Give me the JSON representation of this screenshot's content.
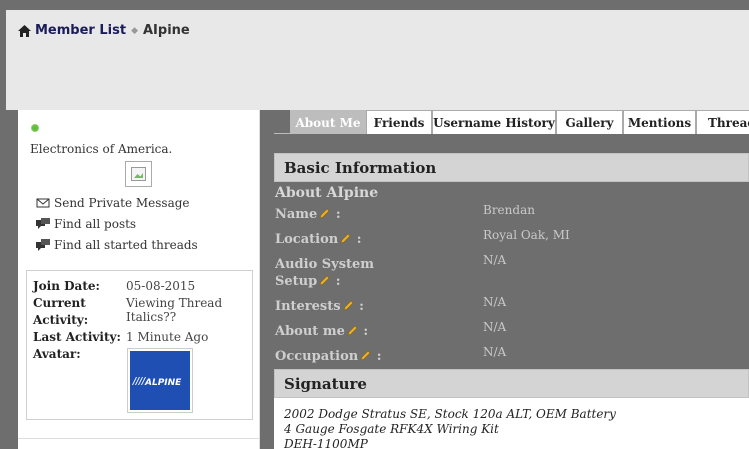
{
  "breadcrumb": {
    "home_icon": "home-icon",
    "link": "Member List",
    "separator_icon": "chevron-right-icon",
    "current": "AIpine"
  },
  "sidebar": {
    "status": "online",
    "usertitle": "Electronics of America.",
    "actions": [
      {
        "icon": "envelope-icon",
        "label": "Send Private Message"
      },
      {
        "icon": "posts-icon",
        "label": "Find all posts"
      },
      {
        "icon": "threads-icon",
        "label": "Find all started threads"
      }
    ],
    "stats": {
      "join_date_label": "Join Date:",
      "join_date": "05-08-2015",
      "current_activity_label_1": "Current",
      "current_activity_label_2": "Activity:",
      "current_activity_1": "Viewing Thread",
      "current_activity_2": "Italics??",
      "last_activity_label": "Last Activity:",
      "last_activity": "1 Minute Ago",
      "avatar_label": "Avatar:"
    },
    "avatar_logo_text": "ALPINE"
  },
  "tabs": [
    {
      "label": "About Me",
      "active": true
    },
    {
      "label": "Friends",
      "active": false
    },
    {
      "label": "Username History",
      "active": false
    },
    {
      "label": "Gallery",
      "active": false
    },
    {
      "label": "Mentions",
      "active": false
    },
    {
      "label": "Thread",
      "active": false
    }
  ],
  "basic_info": {
    "header": "Basic Information",
    "about_title": "About AIpine",
    "fields": [
      {
        "label": "Name",
        "value": "Brendan"
      },
      {
        "label": "Location",
        "value": "Royal Oak, MI"
      },
      {
        "label_1": "Audio System",
        "label_2": "Setup",
        "value": "N/A"
      },
      {
        "label": "Interests",
        "value": "N/A"
      },
      {
        "label": "About me",
        "value": "N/A"
      },
      {
        "label": "Occupation",
        "value": "N/A"
      }
    ]
  },
  "signature": {
    "header": "Signature",
    "lines": [
      "2002 Dodge Stratus SE, Stock 120a ALT, OEM Battery",
      "4 Gauge Fosgate RFK4X Wiring Kit",
      "DEH-1100MP"
    ]
  }
}
